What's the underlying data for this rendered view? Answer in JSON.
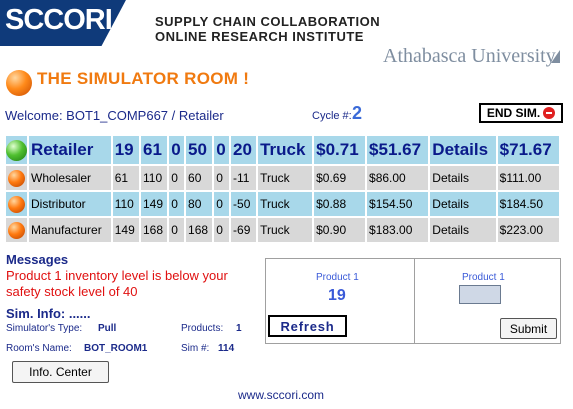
{
  "header": {
    "logo": "SCCORI",
    "line1": "SUPPLY CHAIN COLLABORATION",
    "line2": "ONLINE RESEARCH INSTITUTE",
    "university": "Athabasca University"
  },
  "room_title": "THE SIMULATOR ROOM !",
  "welcome": "Welcome: BOT1_COMP667 / Retailer",
  "cycle_label": "Cycle #:",
  "cycle": "2",
  "end_sim": "END SIM.",
  "table": {
    "head": {
      "role": "Retailer",
      "c1": "19",
      "c2": "61",
      "c3": "0",
      "c4": "50",
      "c5": "0",
      "c6": "20",
      "transport": "Truck",
      "price": "$0.71",
      "cost": "$51.67",
      "details": "Details",
      "total": "$71.67"
    },
    "rows": [
      {
        "role": "Wholesaler",
        "c1": "61",
        "c2": "110",
        "c3": "0",
        "c4": "60",
        "c5": "0",
        "c6": "-11",
        "transport": "Truck",
        "price": "$0.69",
        "cost": "$86.00",
        "details": "Details",
        "total": "$111.00"
      },
      {
        "role": "Distributor",
        "c1": "110",
        "c2": "149",
        "c3": "0",
        "c4": "80",
        "c5": "0",
        "c6": "-50",
        "transport": "Truck",
        "price": "$0.88",
        "cost": "$154.50",
        "details": "Details",
        "total": "$184.50"
      },
      {
        "role": "Manufacturer",
        "c1": "149",
        "c2": "168",
        "c3": "0",
        "c4": "168",
        "c5": "0",
        "c6": "-69",
        "transport": "Truck",
        "price": "$0.90",
        "cost": "$183.00",
        "details": "Details",
        "total": "$223.00"
      }
    ]
  },
  "messages": {
    "title": "Messages",
    "text": "Product 1 inventory level is below your safety stock level of 40"
  },
  "sim_info": {
    "title": "Sim. Info: ......",
    "type_label": "Simulator's Type:",
    "type_value": "Pull",
    "room_label": "Room's Name:",
    "room_value": "BOT_ROOM1",
    "products_label": "Products:",
    "products_value": "1",
    "sim_label": "Sim #:",
    "sim_value": "114"
  },
  "info_center": "Info. Center",
  "panel": {
    "product_label": "Product 1",
    "product_value": "19",
    "order_label": "Product 1",
    "order_value": "",
    "refresh": "Refresh",
    "submit": "Submit"
  },
  "footer": "www.sccori.com"
}
